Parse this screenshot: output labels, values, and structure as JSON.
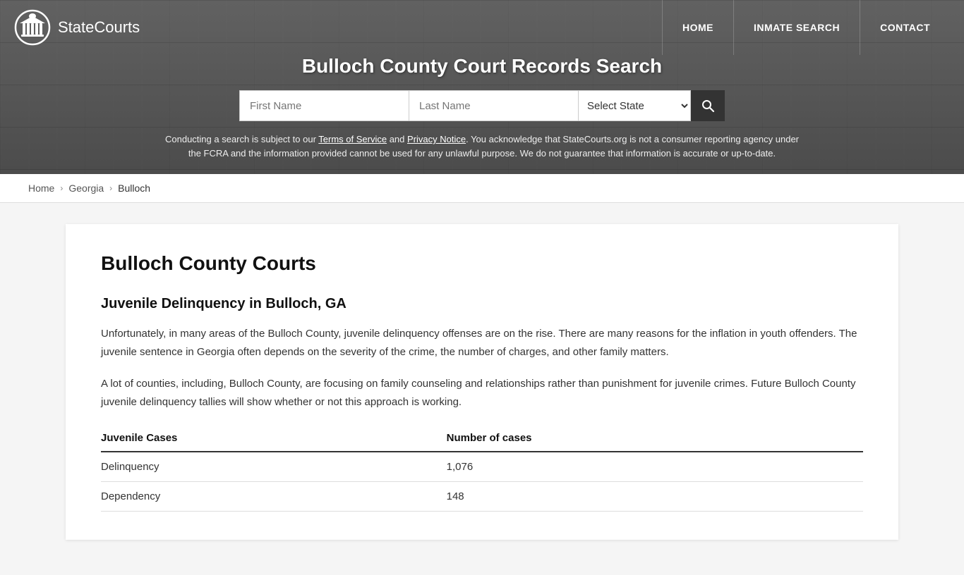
{
  "site": {
    "logo_text_bold": "State",
    "logo_text_normal": "Courts",
    "logo_icon": "⊙"
  },
  "nav": {
    "home_label": "HOME",
    "inmate_search_label": "INMATE SEARCH",
    "contact_label": "CONTACT"
  },
  "header": {
    "page_title": "Bulloch County Court Records Search",
    "search": {
      "first_name_placeholder": "First Name",
      "last_name_placeholder": "Last Name",
      "state_default": "Select State",
      "search_icon": "🔍"
    },
    "disclaimer_text1": "Conducting a search is subject to our ",
    "tos_label": "Terms of Service",
    "disclaimer_and": " and ",
    "privacy_label": "Privacy Notice",
    "disclaimer_text2": ". You acknowledge that StateCourts.org is not a consumer reporting agency under the FCRA and the information provided cannot be used for any unlawful purpose. We do not guarantee that information is accurate or up-to-date."
  },
  "breadcrumb": {
    "home": "Home",
    "state": "Georgia",
    "county": "Bulloch"
  },
  "content": {
    "section_title": "Bulloch County Courts",
    "subsection_title": "Juvenile Delinquency in Bulloch, GA",
    "para1": "Unfortunately, in many areas of the Bulloch County, juvenile delinquency offenses are on the rise. There are many reasons for the inflation in youth offenders. The juvenile sentence in Georgia often depends on the severity of the crime, the number of charges, and other family matters.",
    "para2": "A lot of counties, including, Bulloch County, are focusing on family counseling and relationships rather than punishment for juvenile crimes. Future Bulloch County juvenile delinquency tallies will show whether or not this approach is working.",
    "table": {
      "col1_header": "Juvenile Cases",
      "col2_header": "Number of cases",
      "rows": [
        {
          "label": "Delinquency",
          "value": "1,076"
        },
        {
          "label": "Dependency",
          "value": "148"
        }
      ]
    }
  }
}
